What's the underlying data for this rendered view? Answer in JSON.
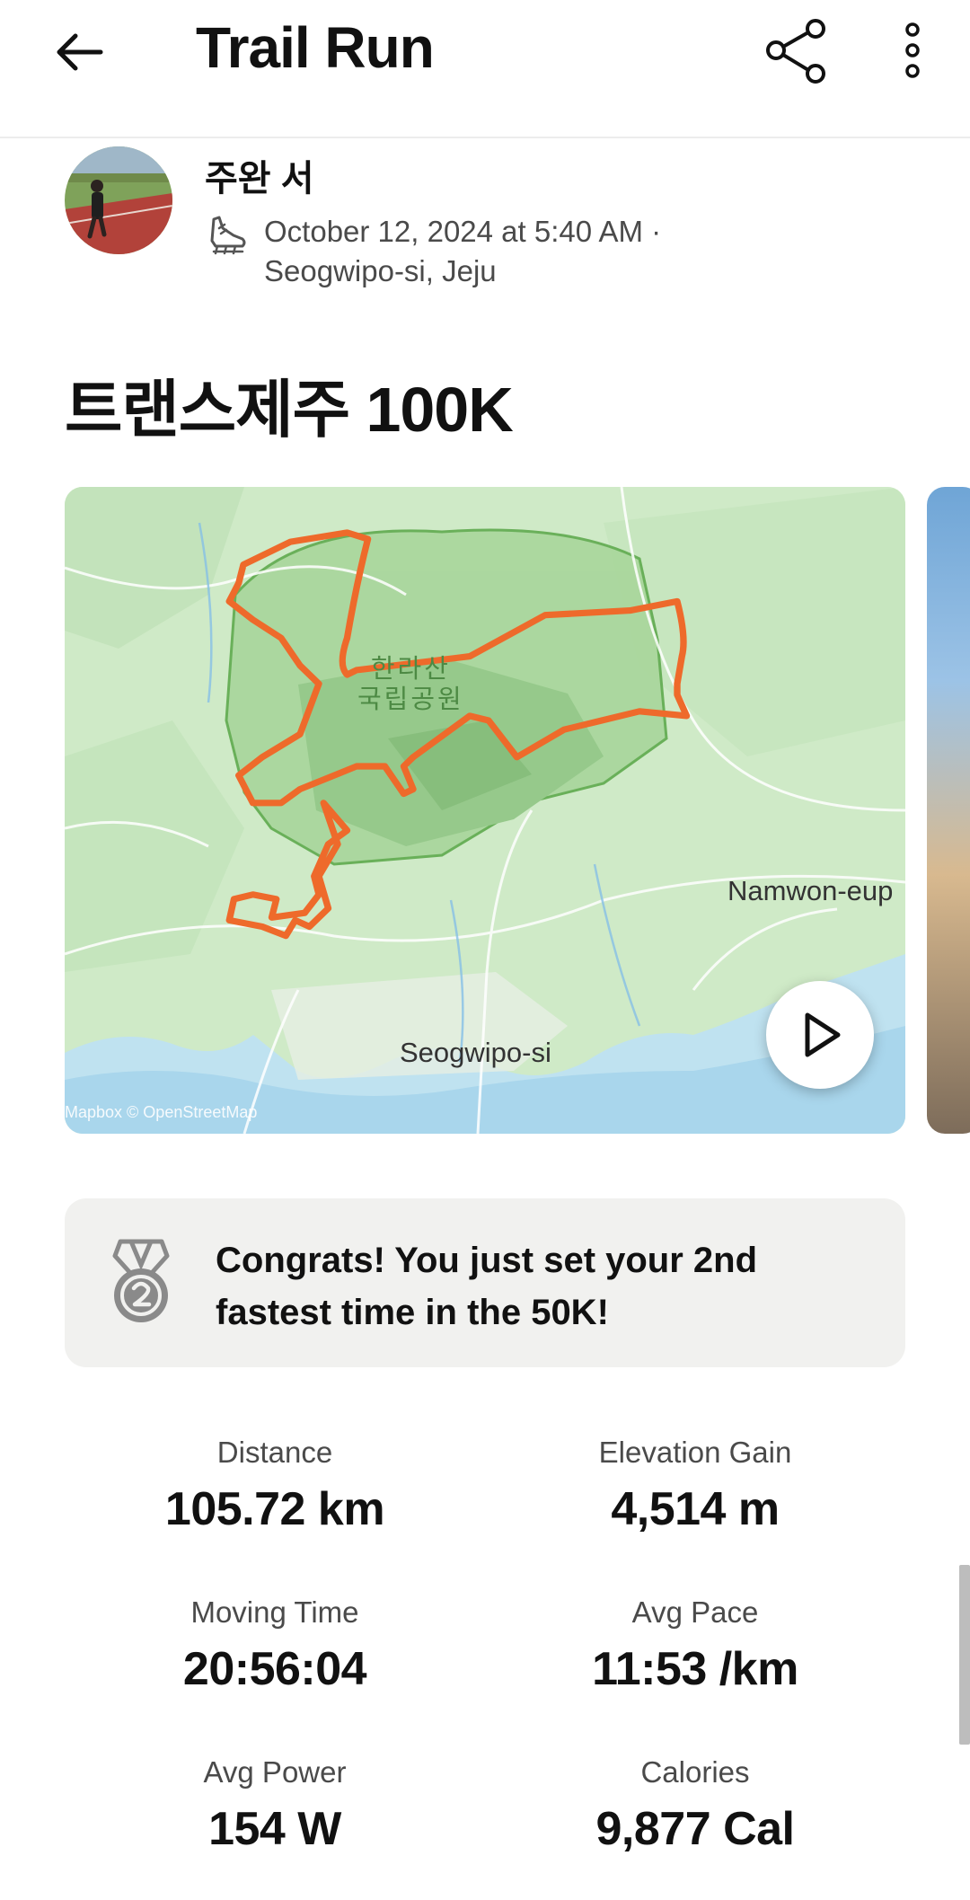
{
  "header": {
    "title": "Trail Run",
    "back_icon": "arrow-left-icon",
    "share_icon": "share-icon",
    "more_icon": "more-vertical-icon"
  },
  "athlete": {
    "name": "주완 서",
    "datetime": "October 12, 2024 at 5:40 AM ·",
    "location": "Seogwipo-si, Jeju",
    "activity_icon": "trail-shoe-icon"
  },
  "activity": {
    "title": "트랜스제주 100K"
  },
  "map": {
    "park_label_line1": "한라산",
    "park_label_line2": "국립공원",
    "town_label_1": "Namwon-eup",
    "town_label_2": "Seogwipo-si",
    "attribution": "Mapbox © OpenStreetMap",
    "route_color": "#fc5200",
    "play_icon": "play-icon"
  },
  "achievement": {
    "icon": "medal-2nd-icon",
    "text": "Congrats! You just set your 2nd fastest time in the 50K!"
  },
  "stats": [
    {
      "label": "Distance",
      "value": "105.72 km"
    },
    {
      "label": "Elevation Gain",
      "value": "4,514 m"
    },
    {
      "label": "Moving Time",
      "value": "20:56:04"
    },
    {
      "label": "Avg Pace",
      "value": "11:53 /km"
    },
    {
      "label": "Avg Power",
      "value": "154 W"
    },
    {
      "label": "Calories",
      "value": "9,877 Cal"
    }
  ]
}
